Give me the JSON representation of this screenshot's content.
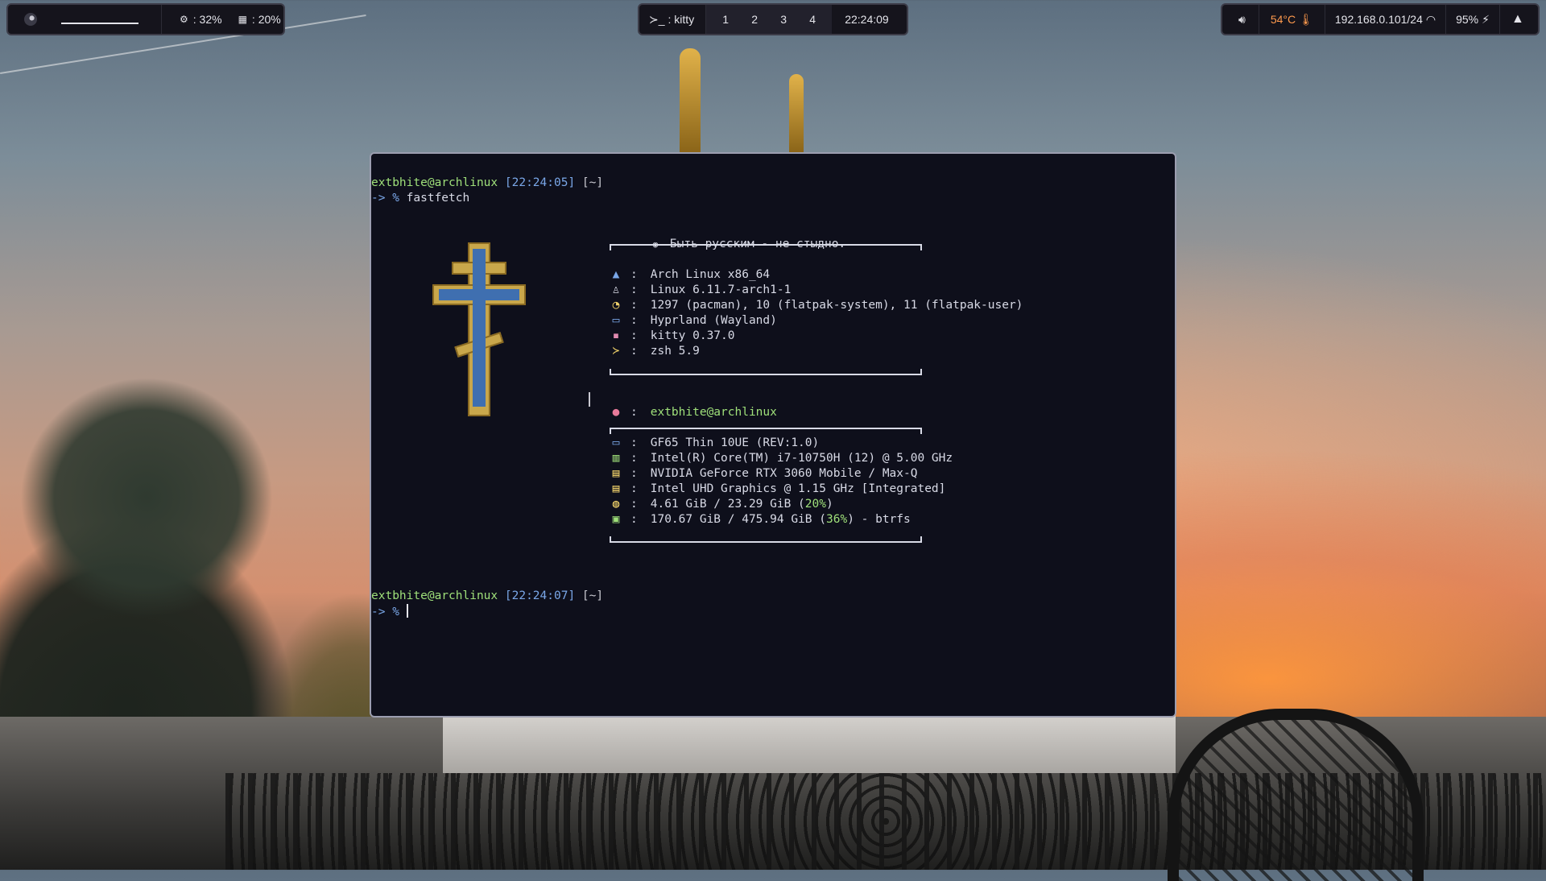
{
  "topbar": {
    "left": {
      "cpu_label": ": 32%",
      "ram_label": ": 20%"
    },
    "center": {
      "terminal_label": ": kitty",
      "workspaces": [
        "1",
        "2",
        "3",
        "4"
      ],
      "clock": "22:24:09"
    },
    "right": {
      "temperature": "54°C",
      "network": "192.168.0.101/24",
      "battery": "95%"
    }
  },
  "terminal": {
    "prompt1": {
      "user": "extbhite@archlinux",
      "time": "[22:24:05]",
      "dir": "[~]",
      "arrow": "-> %",
      "command": "fastfetch"
    },
    "fastfetch": {
      "header": "Быть русским - не стыдно.",
      "os": "Arch Linux x86_64",
      "kernel": "Linux 6.11.7-arch1-1",
      "packages": "1297 (pacman), 10 (flatpak-system), 11 (flatpak-user)",
      "wm": "Hyprland (Wayland)",
      "terminal": "kitty 0.37.0",
      "shell": "zsh 5.9",
      "user_host": "extbhite@archlinux",
      "host": "GF65 Thin 10UE (REV:1.0)",
      "cpu": "Intel(R) Core(TM) i7-10750H (12) @ 5.00 GHz",
      "gpu1": "NVIDIA GeForce RTX 3060 Mobile / Max-Q",
      "gpu2": "Intel UHD Graphics @ 1.15 GHz [Integrated]",
      "memory_prefix": "4.61 GiB / 23.29 GiB (",
      "memory_pct": "20%",
      "memory_suffix": ")",
      "disk_prefix": "170.67 GiB / 475.94 GiB (",
      "disk_pct": "36%",
      "disk_suffix": ") - btrfs",
      "colon": ":"
    },
    "prompt2": {
      "user": "extbhite@archlinux",
      "time": "[22:24:07]",
      "dir": "[~]",
      "arrow": "-> %"
    }
  },
  "colors": {
    "terminal_bg": "#0e0f1b",
    "prompt_user": "#9fe07a",
    "prompt_time": "#7aa7e8",
    "temperature": "#ff9a4d"
  },
  "icons": {
    "os": "arch-logo-icon",
    "kernel": "tux-icon",
    "packages": "package-icon",
    "wm": "monitor-icon",
    "terminal": "terminal-app-icon",
    "shell": "prompt-icon",
    "user": "user-icon",
    "host": "laptop-icon",
    "cpu": "cpu-chip-icon",
    "gpu": "gpu-icon",
    "memory": "memory-icon",
    "disk": "disk-icon"
  }
}
